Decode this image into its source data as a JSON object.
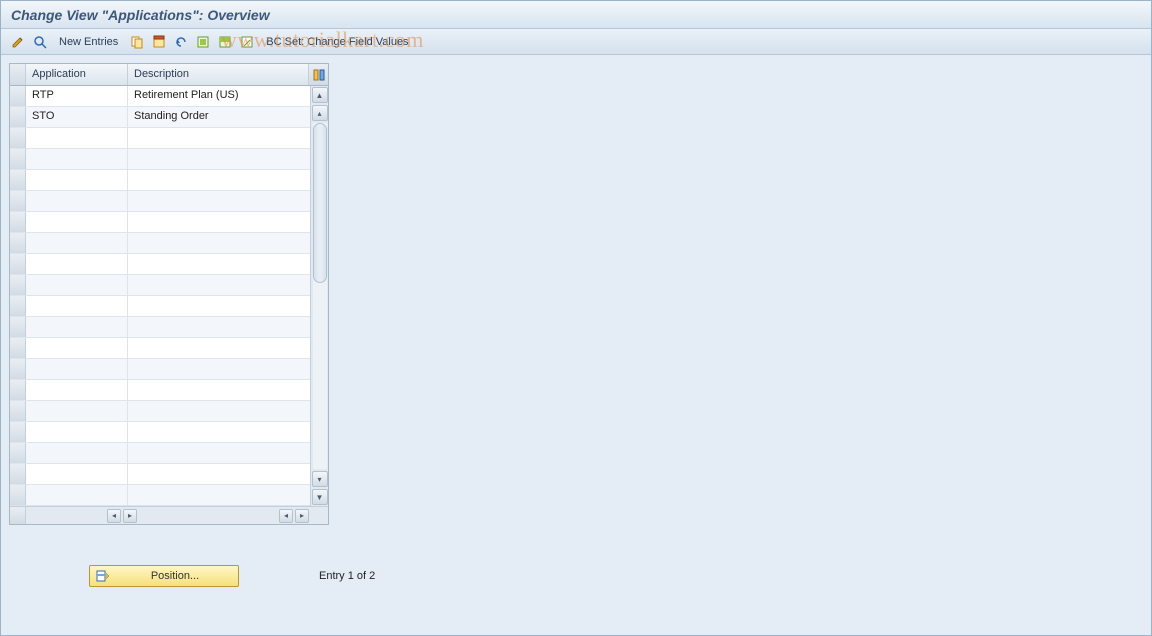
{
  "title": "Change View \"Applications\": Overview",
  "toolbar": {
    "new_entries": "New Entries",
    "bc_set": "BC Set: Change Field Values"
  },
  "watermark": "www.tutorialkart.com",
  "table": {
    "headers": {
      "application": "Application",
      "description": "Description"
    },
    "rows": [
      {
        "application": "RTP",
        "description": "Retirement Plan (US)"
      },
      {
        "application": "STO",
        "description": "Standing Order"
      }
    ],
    "empty_rows": 18
  },
  "position_button": "Position...",
  "entry_status": "Entry 1 of 2"
}
